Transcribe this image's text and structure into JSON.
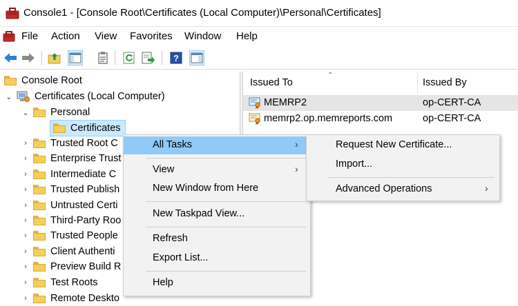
{
  "window": {
    "title": "Console1 - [Console Root\\Certificates (Local Computer)\\Personal\\Certificates]"
  },
  "menubar": {
    "items": [
      "File",
      "Action",
      "View",
      "Favorites",
      "Window",
      "Help"
    ]
  },
  "toolbar": {
    "buttons": [
      "back-icon",
      "forward-icon",
      "up-folder-icon",
      "show-hide-tree-icon",
      "properties-icon",
      "refresh-icon",
      "export-list-icon",
      "help-icon",
      "show-hide-action-pane-icon"
    ]
  },
  "tree": {
    "root": "Console Root",
    "computer": "Certificates (Local Computer)",
    "personal": "Personal",
    "certificates": "Certificates",
    "stores": [
      "Trusted Root C",
      "Enterprise Trust",
      "Intermediate C",
      "Trusted Publish",
      "Untrusted Certi",
      "Third-Party Roo",
      "Trusted People",
      "Client Authenti",
      "Preview Build R",
      "Test Roots",
      "Remote Deskto"
    ]
  },
  "list": {
    "columns": [
      "Issued To",
      "Issued By"
    ],
    "rows": [
      {
        "issued_to": "MEMRP2",
        "issued_by": "op-CERT-CA"
      },
      {
        "issued_to": "memrp2.op.memreports.com",
        "issued_by": "op-CERT-CA"
      }
    ]
  },
  "context_menu": {
    "all_tasks": "All Tasks",
    "view": "View",
    "new_window": "New Window from Here",
    "new_taskpad": "New Taskpad View...",
    "refresh": "Refresh",
    "export_list": "Export List...",
    "help": "Help"
  },
  "submenu": {
    "request_new_certificate": "Request New Certificate...",
    "import": "Import...",
    "advanced_operations": "Advanced Operations"
  },
  "colors": {
    "menu_highlight": "#91c9f7",
    "tree_selection": "#cce8ff",
    "folder": "#f4cf5c"
  }
}
